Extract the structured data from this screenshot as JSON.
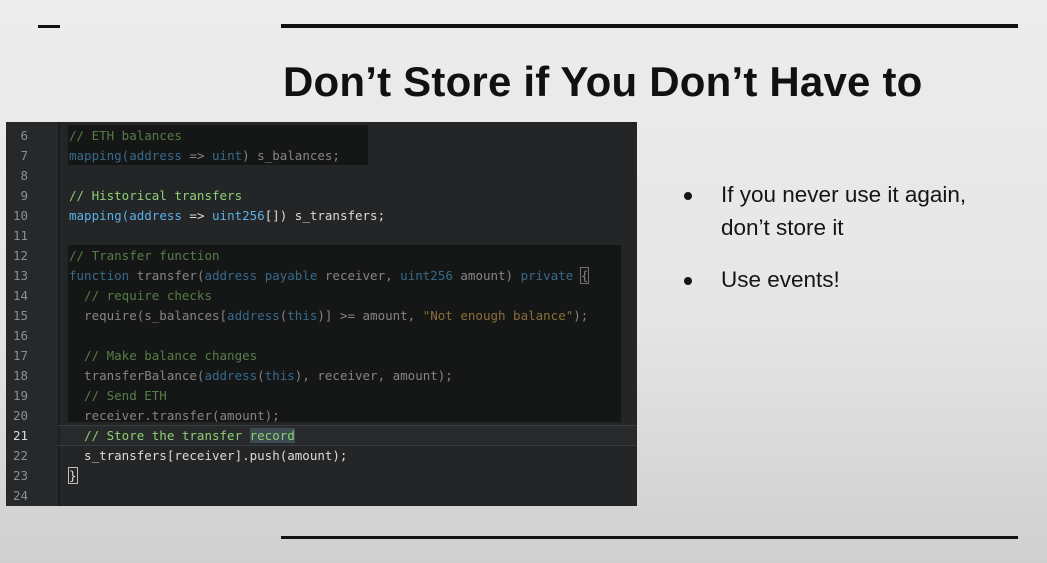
{
  "slide": {
    "title": "Don’t Store if You Don’t Have to",
    "bullets": [
      "If you never use it again, don’t store it",
      "Use events!"
    ]
  },
  "code": {
    "lines": [
      {
        "n": "6",
        "segments": [
          {
            "t": "// ETH balances",
            "c": "comment"
          }
        ]
      },
      {
        "n": "7",
        "segments": [
          {
            "t": "mapping(",
            "c": "kw"
          },
          {
            "t": "address",
            "c": "kw"
          },
          {
            "t": " => ",
            "c": "plain"
          },
          {
            "t": "uint",
            "c": "kw"
          },
          {
            "t": ") s_balances;",
            "c": "plain"
          }
        ]
      },
      {
        "n": "8",
        "segments": []
      },
      {
        "n": "9",
        "segments": [
          {
            "t": "// Historical transfers",
            "c": "comment"
          }
        ]
      },
      {
        "n": "10",
        "segments": [
          {
            "t": "mapping(",
            "c": "kw"
          },
          {
            "t": "address",
            "c": "kw"
          },
          {
            "t": " => ",
            "c": "plain"
          },
          {
            "t": "uint256",
            "c": "kw"
          },
          {
            "t": "[]) s_transfers;",
            "c": "plain"
          }
        ]
      },
      {
        "n": "11",
        "segments": []
      },
      {
        "n": "12",
        "segments": [
          {
            "t": "// Transfer function",
            "c": "comment"
          }
        ]
      },
      {
        "n": "13",
        "segments": [
          {
            "t": "function ",
            "c": "kw"
          },
          {
            "t": "transfer(",
            "c": "plain"
          },
          {
            "t": "address ",
            "c": "kw"
          },
          {
            "t": "payable ",
            "c": "kw"
          },
          {
            "t": "receiver, ",
            "c": "plain"
          },
          {
            "t": "uint256 ",
            "c": "kw"
          },
          {
            "t": "amount) ",
            "c": "plain"
          },
          {
            "t": "private ",
            "c": "kw"
          },
          {
            "t": "{",
            "c": "plain",
            "box": true
          }
        ]
      },
      {
        "n": "14",
        "segments": [
          {
            "t": "  // require checks",
            "c": "comment"
          }
        ]
      },
      {
        "n": "15",
        "segments": [
          {
            "t": "  require(s_balances[",
            "c": "plain"
          },
          {
            "t": "address",
            "c": "kw"
          },
          {
            "t": "(",
            "c": "plain"
          },
          {
            "t": "this",
            "c": "kw"
          },
          {
            "t": ")] >= amount, ",
            "c": "plain"
          },
          {
            "t": "\"Not enough balance\"",
            "c": "str"
          },
          {
            "t": ");",
            "c": "plain"
          }
        ]
      },
      {
        "n": "16",
        "segments": []
      },
      {
        "n": "17",
        "segments": [
          {
            "t": "  // Make balance changes",
            "c": "comment"
          }
        ]
      },
      {
        "n": "18",
        "segments": [
          {
            "t": "  transferBalance(",
            "c": "plain"
          },
          {
            "t": "address",
            "c": "kw"
          },
          {
            "t": "(",
            "c": "plain"
          },
          {
            "t": "this",
            "c": "kw"
          },
          {
            "t": "), receiver, amount);",
            "c": "plain"
          }
        ]
      },
      {
        "n": "19",
        "segments": [
          {
            "t": "  // Send ETH",
            "c": "comment"
          }
        ]
      },
      {
        "n": "20",
        "segments": [
          {
            "t": "  receiver.transfer(amount);",
            "c": "plain"
          }
        ]
      },
      {
        "n": "21",
        "active": true,
        "segments": [
          {
            "t": "  // Store the transfer ",
            "c": "comment"
          },
          {
            "t": "record",
            "c": "comment",
            "hl": true
          }
        ]
      },
      {
        "n": "22",
        "segments": [
          {
            "t": "  s_transfers[receiver].push(amount);",
            "c": "plain"
          }
        ]
      },
      {
        "n": "23",
        "segments": [
          {
            "t": "}",
            "c": "plain",
            "box": true
          }
        ]
      },
      {
        "n": "24",
        "segments": []
      }
    ]
  },
  "colors": {
    "comment": "#8fcf75",
    "keyword": "#5cb0e6",
    "string": "#e6b85c",
    "plain": "#dcdcdc",
    "editor_bg": "#232526"
  }
}
